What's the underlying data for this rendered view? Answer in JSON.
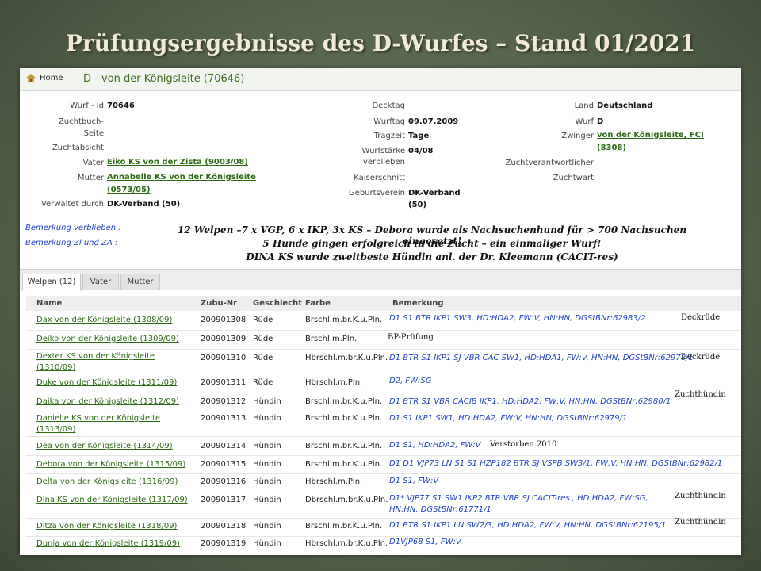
{
  "slide_title": "Prüfungsergebnisse des D-Wurfes – Stand 01/2021",
  "header": {
    "home": "Home",
    "title": "D - von der Königsleite (70646)"
  },
  "details": {
    "wurf_id_label": "Wurf - Id",
    "wurf_id": "70646",
    "zuchtbuch_label_1": "Zuchtbuch-",
    "zuchtbuch_label_2": "Seite",
    "zuchtabsicht_label": "Zuchtabsicht",
    "vater_label": "Vater",
    "vater": "Eiko KS von der Zista (9003/08)",
    "mutter_label": "Mutter",
    "mutter_1": "Annabelle KS von der Königsleite",
    "mutter_2": "(0573/05)",
    "verwaltet_label": "Verwaltet durch",
    "verwaltet": "DK-Verband (50)",
    "decktag_label": "Decktag",
    "wurftag_label": "Wurftag",
    "wurftag": "09.07.2009",
    "tragzeit_label": "Tragzeit",
    "tragzeit": "Tage",
    "wurfstaerke_label_1": "Wurfstärke",
    "wurfstaerke_label_2": "verblieben",
    "wurfstaerke": "04/08",
    "kaiserschnitt_label": "Kaiserschnitt",
    "geburtsverein_label": "Geburtsverein",
    "geburtsverein_1": "DK-Verband",
    "geburtsverein_2": "(50)",
    "land_label": "Land",
    "land": "Deutschland",
    "wurf_label": "Wurf",
    "wurf": "D",
    "zwinger_label": "Zwinger",
    "zwinger_1": "von der Königsleite, FCI",
    "zwinger_2": "(8308)",
    "zuchtverantwortlicher_label": "Zuchtverantwortlicher",
    "zuchtwart_label": "Zuchtwart"
  },
  "notes": {
    "verblieben_label": "Bemerkung verblieben :",
    "zl_za_label": "Bemerkung Zl und ZA :",
    "line1": "12 Welpen –7 x VGP, 6 x IKP, 3x KS – Debora wurde als Nachsuchenhund für > 700 Nachsuchen eingesetzt!",
    "line2": "5 Hunde gingen erfolgreich in die Zucht – ein einmaliger Wurf!",
    "line3": "DINA KS  wurde zweitbeste Hündin anl. der Dr. Kleemann (CACIT-res)"
  },
  "tabs": [
    "Welpen (12)",
    "Vater",
    "Mutter"
  ],
  "columns": [
    "Name",
    "Zubu-Nr",
    "Geschlecht",
    "Farbe",
    "Bemerkung"
  ],
  "rows": [
    {
      "name": "Dax von der Königsleite (1308/09)",
      "zubu": "200901308",
      "sex": "Rüde",
      "color": "Brschl.m.br.K.u.Pln.",
      "note": "D1 S1 BTR IKP1 SW3, HD:HDA2, FW:V, HN:HN, DGStBNr:62983/2",
      "extra": "Deckrüde"
    },
    {
      "name": "Deiko von der Königsleite (1309/09)",
      "zubu": "200901309",
      "sex": "Rüde",
      "color": "Brschl.m.Pln.",
      "note": "",
      "extra": "BP-Prüfung"
    },
    {
      "name": "Dexter KS von der Königsleite (1310/09)",
      "zubu": "200901310",
      "sex": "Rüde",
      "color": "Hbrschl.m.br.K.u.Pln.",
      "note": "D1 BTR S1 IKP1 SJ VBR CAC SW1, HD:HDA1, FW:V, HN:HN, DGStBNr:62978/1",
      "extra": "Deckrüde"
    },
    {
      "name": "Duke von der Königsleite (1311/09)",
      "zubu": "200901311",
      "sex": "Rüde",
      "color": "Hbrschl.m.Pln.",
      "note": "D2, FW:SG",
      "extra": ""
    },
    {
      "name": "Daika von der Königsleite (1312/09)",
      "zubu": "200901312",
      "sex": "Hündin",
      "color": "Brschl.m.br.K.u.Pln.",
      "note": "D1 BTR S1 VBR CACIB IKP1, HD:HDA2, FW:V, HN:HN, DGStBNr:62980/1",
      "extra": "Zuchthündin"
    },
    {
      "name": "Danielle KS von der Königsleite (1313/09)",
      "zubu": "200901313",
      "sex": "Hündin",
      "color": "Brschl.m.br.K.u.Pln.",
      "note": "D1 S1 IKP1 SW1, HD:HDA2, FW:V, HN:HN, DGStBNr:62979/1",
      "extra": ""
    },
    {
      "name": "Dea von der Königsleite (1314/09)",
      "zubu": "200901314",
      "sex": "Hündin",
      "color": "Brschl.m.br.K.u.Pln.",
      "note": "D1 S1, HD:HDA2, FW:V",
      "extra": "Verstorben 2010"
    },
    {
      "name": "Debora von der Königsleite (1315/09)",
      "zubu": "200901315",
      "sex": "Hündin",
      "color": "Brschl.m.br.K.u.Pln.",
      "note": "D1 D1 VJP73 LN S1 S1 HZP182 BTR SJ VSPB SW3/1, FW:V, HN:HN, DGStBNr:62982/1",
      "extra": ""
    },
    {
      "name": "Delta von der Königsleite (1316/09)",
      "zubu": "200901316",
      "sex": "Hündin",
      "color": "Hbrschl.m.Pln.",
      "note": "D1 S1, FW:V",
      "extra": ""
    },
    {
      "name": "Dina KS von der Königsleite (1317/09)",
      "zubu": "200901317",
      "sex": "Hündin",
      "color": "Dbrschl.m.br.K.u.Pln.",
      "note": "D1* VJP77 S1 SW1 IKP2 BTR VBR SJ CACIT-res., HD:HDA2, FW:SG, HN:HN, DGStBNr:61771/1",
      "extra": "Zuchthündin"
    },
    {
      "name": "Ditza von der Königsleite (1318/09)",
      "zubu": "200901318",
      "sex": "Hündin",
      "color": "Brschl.m.br.K.u.Pln.",
      "note": "D1 BTR S1 IKP1 LN SW2/3, HD:HDA2, FW:V, HN:HN, DGStBNr:62195/1",
      "extra": "Zuchthündin"
    },
    {
      "name": "Dunja von der Königsleite (1319/09)",
      "zubu": "200901319",
      "sex": "Hündin",
      "color": "Hbrschl.m.br.K.u.Pln.",
      "note": "D1VJP68 S1, FW:V",
      "extra": ""
    }
  ]
}
